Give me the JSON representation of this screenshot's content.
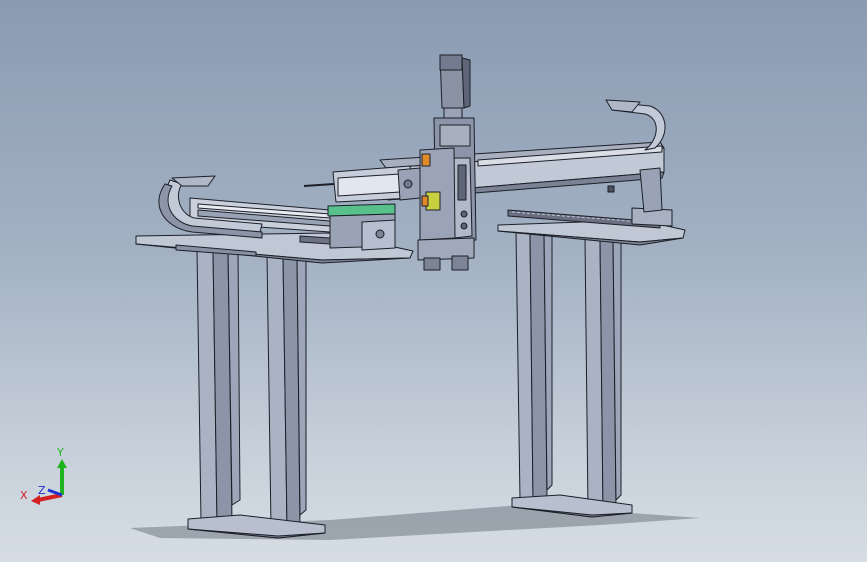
{
  "triad": {
    "x_label": "X",
    "y_label": "Y",
    "z_label": "Z",
    "x_color": "#d42020",
    "y_color": "#1fb41f",
    "z_color": "#2030d0"
  },
  "model": {
    "steel_color": "#b4bccc",
    "dark_steel_color": "#6d7384",
    "outline_color": "#1c1f28",
    "accent_green": "#58c08a",
    "accent_orange": "#e08a2a",
    "accent_yellow": "#c8d040"
  }
}
